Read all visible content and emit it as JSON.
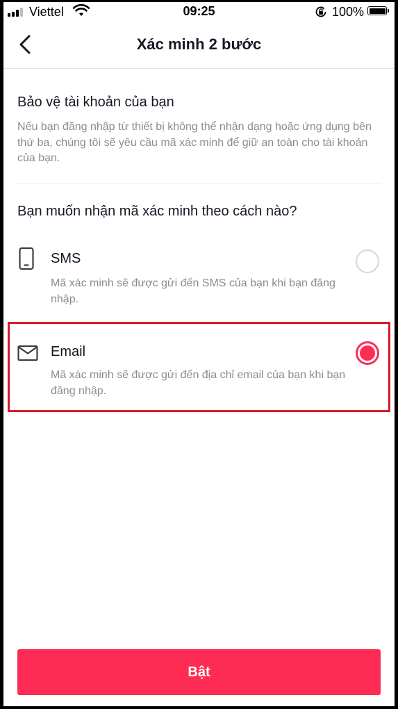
{
  "status_bar": {
    "carrier": "Viettel",
    "time": "09:25",
    "battery": "100%",
    "signal_bars": 4,
    "signal_bars_active": 3
  },
  "nav": {
    "back_icon": "chevron-left-icon",
    "title": "Xác minh 2 bước"
  },
  "intro": {
    "title": "Bảo vệ tài khoản của bạn",
    "description": "Nếu bạn đăng nhập từ thiết bị không thể nhận dạng hoặc ứng dụng bên thứ ba, chúng tôi sẽ yêu cầu mã xác minh để giữ an toàn cho tài khoản của bạn."
  },
  "question": "Bạn muốn nhận mã xác minh theo cách nào?",
  "options": [
    {
      "icon": "phone-icon",
      "label": "SMS",
      "description": "Mã xác minh sẽ được gửi đến SMS của bạn khi bạn đăng nhập.",
      "selected": false
    },
    {
      "icon": "mail-icon",
      "label": "Email",
      "description": "Mã xác minh sẽ được gửi đến địa chỉ email của bạn khi bạn đăng nhập.",
      "selected": true
    }
  ],
  "enable_button": {
    "label": "Bật"
  },
  "colors": {
    "accent": "#fe2c55",
    "highlight_border": "#d7192b",
    "text_primary": "#161823",
    "text_secondary": "#8a8b91"
  }
}
